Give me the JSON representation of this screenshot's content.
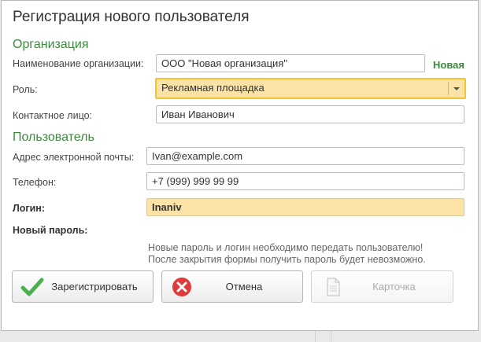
{
  "dialog": {
    "title": "Регистрация нового пользователя"
  },
  "organization": {
    "section_title": "Организация",
    "name_label": "Наименование организации:",
    "name_value": "ООО \"Новая организация\"",
    "new_badge": "Новая",
    "role_label": "Роль:",
    "role_value": "Рекламная площадка",
    "contact_label": "Контактное лицо:",
    "contact_value": "Иван Иванович"
  },
  "user": {
    "section_title": "Пользователь",
    "email_label": "Адрес электронной почты:",
    "email_value": "Ivan@example.com",
    "phone_label": "Телефон:",
    "phone_value": "+7 (999) 999 99 99",
    "login_label": "Логин:",
    "login_value": "Inaniv",
    "password_label": "Новый пароль:",
    "note_line1": "Новые пароль и логин необходимо передать пользователю!",
    "note_line2": "После закрытия формы получить пароль будет невозможно."
  },
  "buttons": {
    "register_label": "Зарегистрировать",
    "cancel_label": "Отмена",
    "card_label": "Карточка"
  },
  "icons": {
    "register": "checkmark-icon",
    "cancel": "cancel-circle-icon",
    "card": "document-icon",
    "dropdown": "chevron-down-icon"
  },
  "colors": {
    "section_green": "#3d8a3d",
    "highlight_yellow": "#fbe3a8",
    "focus_border": "#f3c42e",
    "check_green": "#4caf50",
    "cancel_red": "#e03a3a"
  }
}
